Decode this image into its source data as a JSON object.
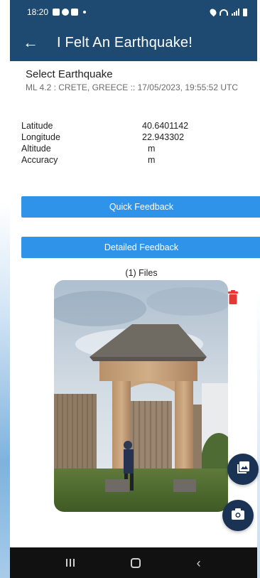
{
  "status_bar": {
    "time": "18:20"
  },
  "app_bar": {
    "back_icon": "arrow-left-icon",
    "title": "I Felt An Earthquake!"
  },
  "earthquake": {
    "section_title": "Select Earthquake",
    "info": "ML 4.2 : CRETE, GREECE :: 17/05/2023, 19:55:52 UTC"
  },
  "location": {
    "rows": [
      {
        "label": "Latitude",
        "value": "40.6401142"
      },
      {
        "label": "Longitude",
        "value": "22.943302"
      },
      {
        "label": "Altitude",
        "value": "m"
      },
      {
        "label": "Accuracy",
        "value": "m"
      }
    ]
  },
  "buttons": {
    "quick_feedback": "Quick Feedback",
    "detailed_feedback": "Detailed Feedback"
  },
  "files": {
    "label": "(1) Files"
  },
  "icons": {
    "delete": "trash-icon",
    "gallery": "image-gallery-icon",
    "camera": "camera-icon"
  },
  "colors": {
    "header": "#1e4a72",
    "button": "#2f93ea",
    "fab": "#1a3354",
    "delete": "#e53935"
  }
}
